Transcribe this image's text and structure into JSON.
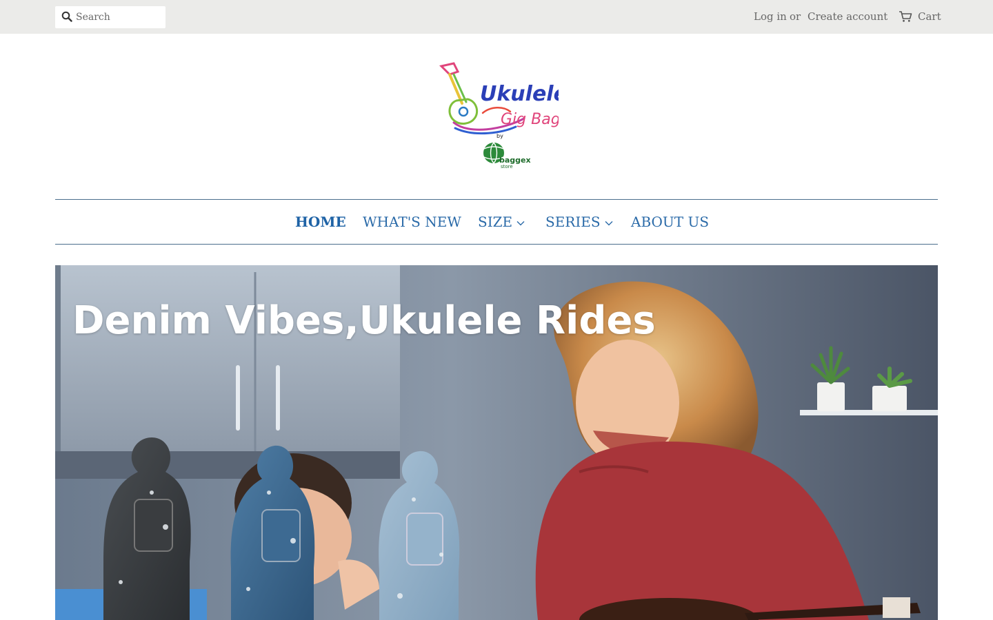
{
  "topbar": {
    "search_placeholder": "Search",
    "login_label": "Log in",
    "or_label": "or",
    "create_account_label": "Create account",
    "cart_label": "Cart"
  },
  "logo": {
    "title_line1": "Ukulele",
    "title_line2": "Gig Bag",
    "by": "by",
    "store_name": "baggex",
    "store_sub": "store"
  },
  "nav": {
    "items": [
      {
        "label": "HOME",
        "active": true
      },
      {
        "label": "WHAT'S NEW"
      },
      {
        "label": "SIZE",
        "has_dropdown": true
      },
      {
        "label": "SERIES",
        "has_dropdown": true
      },
      {
        "label": "ABOUT US"
      }
    ]
  },
  "hero": {
    "title": "Denim Vibes,Ukulele Rides"
  },
  "colors": {
    "topbar_bg": "#ebebe9",
    "nav_link": "#2a6aa8",
    "nav_border": "#4a6d8c"
  },
  "icons": {
    "search": "search-icon",
    "cart": "cart-icon",
    "dropdown": "chevron-down-icon"
  }
}
